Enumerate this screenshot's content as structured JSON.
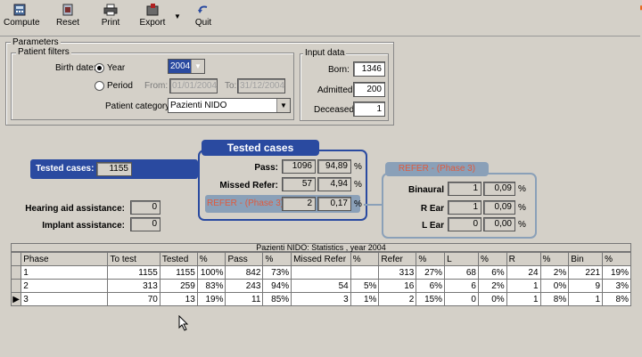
{
  "colors": {
    "accent_blue": "#2a4aa0",
    "orange": "#e8661e",
    "red_text": "#e05a3c"
  },
  "toolbar": {
    "items": [
      {
        "label": "Compute",
        "icon": "calculator-icon"
      },
      {
        "label": "Reset",
        "icon": "reset-icon"
      },
      {
        "label": "Print",
        "icon": "printer-icon"
      },
      {
        "label": "Export",
        "icon": "export-icon"
      },
      {
        "label": "Quit",
        "icon": "quit-arrow-icon"
      }
    ]
  },
  "parameters": {
    "title": "Parameters",
    "patient_filters": {
      "title": "Patient filters",
      "birth_date_label": "Birth date:",
      "year_label": "Year",
      "period_label": "Period",
      "year_value": "2004",
      "from_label": "From:",
      "from_value": "01/01/2004",
      "to_label": "To:",
      "to_value": "31/12/2004",
      "category_label": "Patient category:",
      "category_value": "Pazienti NIDO"
    },
    "input_data": {
      "title": "Input data",
      "born_label": "Born:",
      "born_value": "1346",
      "admitted_label": "Admitted:",
      "admitted_value": "200",
      "deceased_label": "Deceased:",
      "deceased_value": "1"
    }
  },
  "tested": {
    "label": "Tested cases:",
    "value": "1155",
    "hearing_aid_label": "Hearing aid assistance:",
    "hearing_aid_value": "0",
    "implant_label": "Implant assistance:",
    "implant_value": "0"
  },
  "tested_panel": {
    "title": "Tested cases",
    "pass_label": "Pass:",
    "pass_value": "1096",
    "pass_pct": "94,89",
    "missed_label": "Missed Refer:",
    "missed_value": "57",
    "missed_pct": "4,94",
    "refer_label": "REFER - (Phase 3)",
    "refer_value": "2",
    "refer_pct": "0,17",
    "pct_sign": "%"
  },
  "refer_panel": {
    "title": "REFER - (Phase 3)",
    "binaural_label": "Binaural",
    "binaural_value": "1",
    "binaural_pct": "0,09",
    "rear_label": "R Ear",
    "rear_value": "1",
    "rear_pct": "0,09",
    "lear_label": "L Ear",
    "lear_value": "0",
    "lear_pct": "0,00",
    "pct_sign": "%"
  },
  "grid": {
    "title": "Pazienti NIDO: Statistics , year 2004",
    "columns": [
      "Phase",
      "To test",
      "Tested",
      "%",
      "Pass",
      "%",
      "Missed Refer",
      "%",
      "Refer",
      "%",
      "L",
      "%",
      "R",
      "%",
      "Bin",
      "%"
    ],
    "rows": [
      [
        "1",
        "1155",
        "1155",
        "100%",
        "842",
        "73%",
        "",
        "",
        "313",
        "27%",
        "68",
        "6%",
        "24",
        "2%",
        "221",
        "19%"
      ],
      [
        "2",
        "313",
        "259",
        "83%",
        "243",
        "94%",
        "54",
        "5%",
        "16",
        "6%",
        "6",
        "2%",
        "1",
        "0%",
        "9",
        "3%"
      ],
      [
        "3",
        "70",
        "13",
        "19%",
        "11",
        "85%",
        "3",
        "1%",
        "2",
        "15%",
        "0",
        "0%",
        "1",
        "8%",
        "1",
        "8%"
      ]
    ]
  }
}
